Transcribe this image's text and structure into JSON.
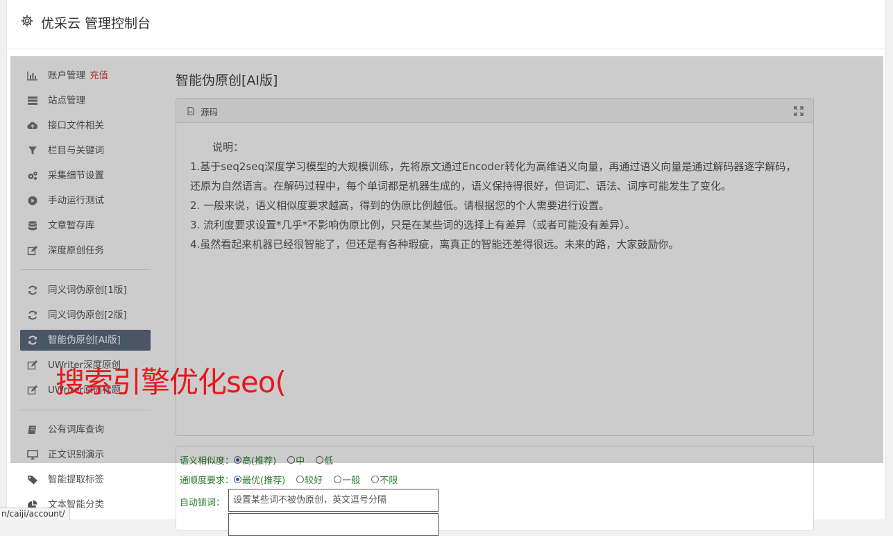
{
  "header": {
    "title": "优采云 管理控制台",
    "icon": "gear-icon"
  },
  "sidebar": {
    "groups": [
      [
        {
          "label": "账户管理",
          "badge": "充值",
          "icon": "bar-chart-icon"
        },
        {
          "label": "站点管理",
          "icon": "server-icon"
        },
        {
          "label": "接口文件相关",
          "icon": "cloud-upload-icon"
        },
        {
          "label": "栏目与关键词",
          "icon": "filter-icon"
        },
        {
          "label": "采集细节设置",
          "icon": "gears-icon"
        },
        {
          "label": "手动运行测试",
          "icon": "play-circle-icon"
        },
        {
          "label": "文章暂存库",
          "icon": "database-icon"
        },
        {
          "label": "深度原创任务",
          "icon": "edit-icon"
        }
      ],
      [
        {
          "label": "同义词伪原创[1版]",
          "icon": "refresh-icon"
        },
        {
          "label": "同义词伪原创[2版]",
          "icon": "refresh-icon"
        },
        {
          "label": "智能伪原创[AI版]",
          "icon": "refresh-icon",
          "active": true
        },
        {
          "label": "UWriter深度原创",
          "icon": "edit-icon"
        },
        {
          "label": "UWriter原创标题",
          "icon": "edit-icon"
        }
      ],
      [
        {
          "label": "公有词库查询",
          "icon": "book-icon"
        },
        {
          "label": "正文识别演示",
          "icon": "monitor-icon"
        },
        {
          "label": "智能提取标签",
          "icon": "tag-icon"
        },
        {
          "label": "文本智能分类",
          "icon": "pie-chart-icon"
        }
      ]
    ]
  },
  "main": {
    "title": "智能伪原创[AI版]",
    "panel": {
      "label": "源码",
      "intro": "说明：",
      "lines": [
        "1.基于seq2seq深度学习模型的大规模训练，先将原文通过Encoder转化为高维语义向量，再通过语义向量是通过解码器逐字解码，还原为自然语言。在解码过程中，每个单词都是机器生成的，语义保持得很好，但词汇、语法、词序可能发生了变化。",
        "2. 一般来说，语义相似度要求越高，得到的伪原比例越低。请根据您的个人需要进行设置。",
        "3. 流利度要求设置*几乎*不影响伪原比例，只是在某些词的选择上有差异（或者可能没有差异）。",
        "4.虽然看起来机器已经很智能了，但还是有各种瑕疵，离真正的智能还差得很远。未来的路，大家鼓励你。"
      ]
    },
    "form": {
      "similarity": {
        "label": "语义相似度：",
        "options": [
          "高(推荐)",
          "中",
          "低"
        ],
        "selected": 0
      },
      "fluency": {
        "label": "通顺度要求：",
        "options": [
          "最优(推荐)",
          "较好",
          "一般",
          "不限"
        ],
        "selected": 0
      },
      "lock": {
        "label": "自动锁词：",
        "placeholder": "设置某些词不被伪原创，英文逗号分隔"
      }
    }
  },
  "overlay_text": "搜索引擎优化seo(",
  "status_url": "n/caiji/account/"
}
